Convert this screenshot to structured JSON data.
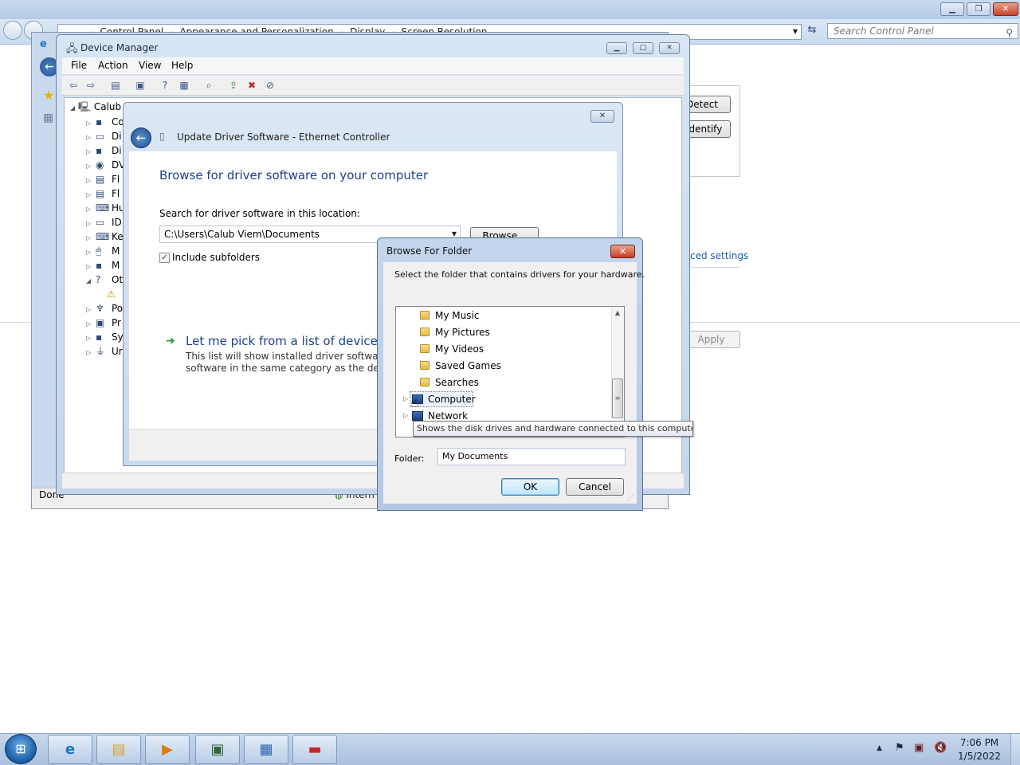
{
  "control_panel": {
    "breadcrumb": [
      "Control Panel",
      "Appearance and Personalization",
      "Display",
      "Screen Resolution"
    ],
    "search_placeholder": "Search Control Panel",
    "detect_label": "Detect",
    "identify_label": "Identify",
    "advanced_label": "ced settings",
    "apply_label": "Apply"
  },
  "ie": {
    "status_done": "Done",
    "status_zone": "Intern"
  },
  "device_manager": {
    "title": "Device Manager",
    "menu": [
      "File",
      "Action",
      "View",
      "Help"
    ],
    "root": "Calub",
    "tree": [
      "Co",
      "Di",
      "Di",
      "DV",
      "Fl",
      "Fl",
      "Hu",
      "ID",
      "Ke",
      "M",
      "M",
      "Ot",
      "",
      "Po",
      "Pr",
      "Sy",
      "Ur"
    ]
  },
  "update_driver": {
    "title": "Update Driver Software - Ethernet Controller",
    "heading": "Browse for driver software on your computer",
    "search_label": "Search for driver software in this location:",
    "path_value": "C:\\Users\\Calub Viem\\Documents",
    "browse_label": "Browse...",
    "include_subfolders": "Include subfolders",
    "pick_title": "Let me pick from a list of device dri",
    "pick_desc_line1": "This list will show installed driver software co",
    "pick_desc_line2": "software in the same category as the device."
  },
  "browse_folder": {
    "title": "Browse For Folder",
    "instruction": "Select the folder that contains drivers for your hardware.",
    "items": [
      "My Music",
      "My Pictures",
      "My Videos",
      "Saved Games",
      "Searches"
    ],
    "computer_label": "Computer",
    "network_label": "Network",
    "tooltip": "Shows the disk drives and hardware connected to this computer.",
    "folder_label": "Folder:",
    "folder_value": "My Documents",
    "ok_label": "OK",
    "cancel_label": "Cancel"
  },
  "taskbar": {
    "time": "7:06 PM",
    "date": "1/5/2022"
  }
}
